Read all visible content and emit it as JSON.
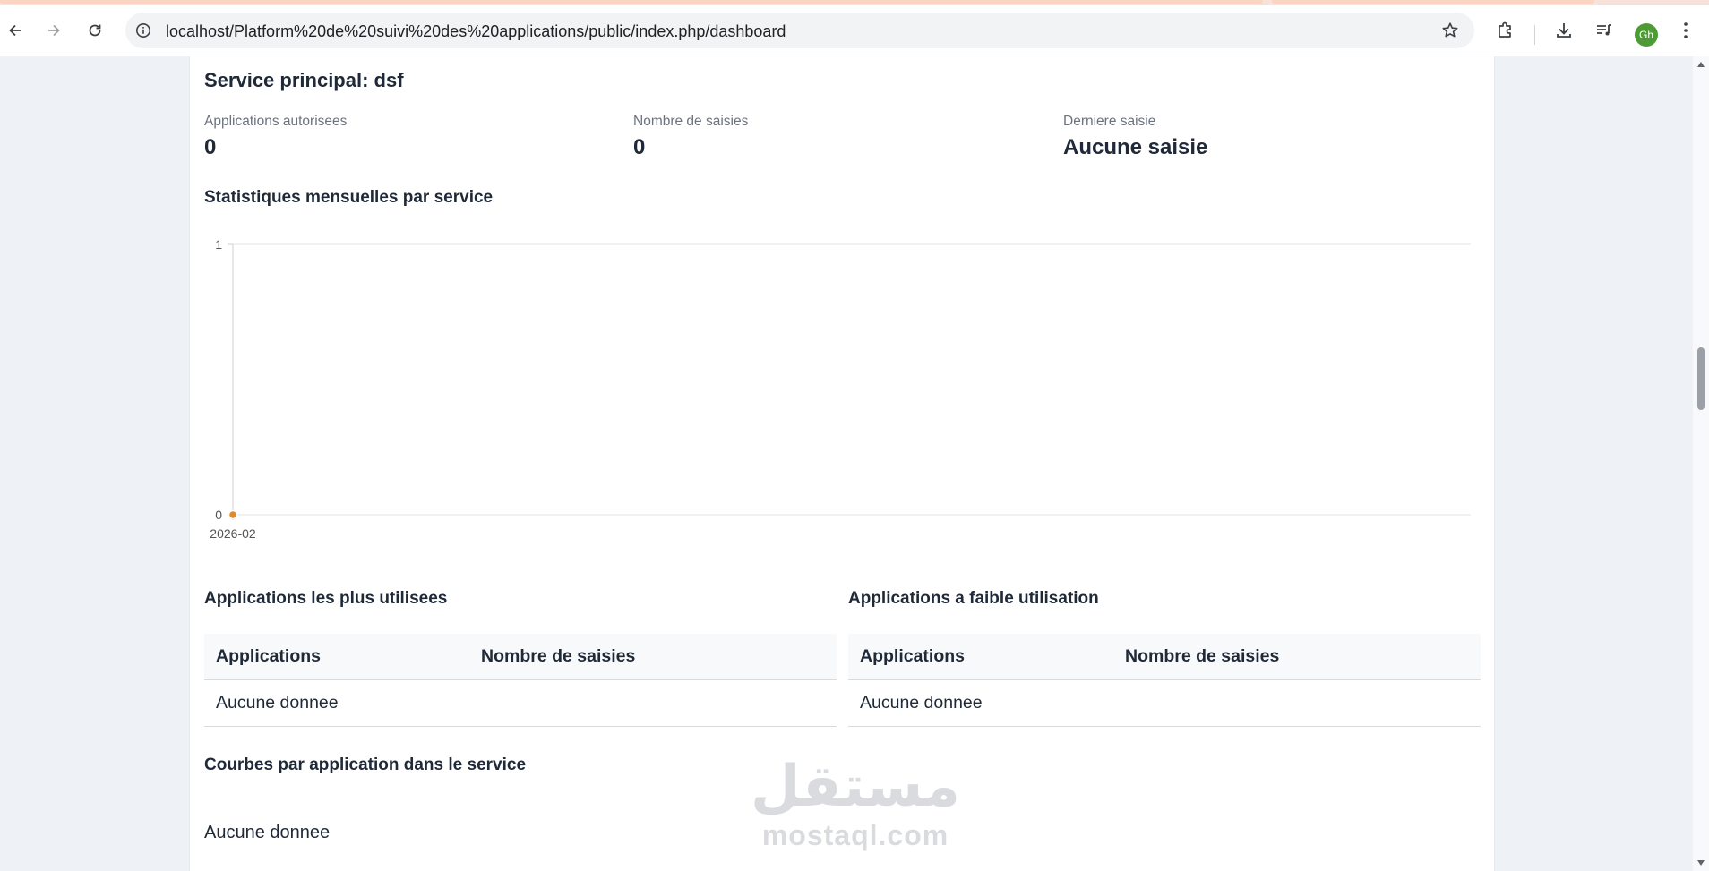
{
  "browser": {
    "url": "localhost/Platform%20de%20suivi%20des%20applications/public/index.php/dashboard",
    "avatar_initials": "Gh",
    "icons": [
      "back-arrow-icon",
      "forward-arrow-icon",
      "reload-icon",
      "site-info-icon",
      "bookmark-star-icon",
      "extensions-puzzle-icon",
      "download-icon",
      "media-queue-icon",
      "kebab-menu-icon"
    ]
  },
  "service": {
    "title": "Service principal: dsf",
    "stats": [
      {
        "label": "Applications autorisees",
        "value": "0"
      },
      {
        "label": "Nombre de saisies",
        "value": "0"
      },
      {
        "label": "Derniere saisie",
        "value": "Aucune saisie"
      }
    ]
  },
  "monthly_chart": {
    "heading": "Statistiques mensuelles par service"
  },
  "chart_data": {
    "type": "line",
    "x": [
      "2026-02"
    ],
    "series": [
      {
        "values": [
          0
        ],
        "color": "#e08a2c"
      }
    ],
    "yticks": [
      "1",
      "0"
    ],
    "ylim": [
      0,
      1
    ],
    "grid": true,
    "title": "",
    "xlabel": "",
    "ylabel": ""
  },
  "most_used": {
    "heading": "Applications les plus utilisees",
    "columns": [
      "Applications",
      "Nombre de saisies"
    ],
    "empty_text": "Aucune donnee"
  },
  "least_used": {
    "heading": "Applications a faible utilisation",
    "columns": [
      "Applications",
      "Nombre de saisies"
    ],
    "empty_text": "Aucune donnee"
  },
  "curves": {
    "heading": "Courbes par application dans le service",
    "empty_text": "Aucune donnee"
  },
  "watermark": {
    "arabic": "مستقل",
    "latin": "mostaql.com"
  }
}
